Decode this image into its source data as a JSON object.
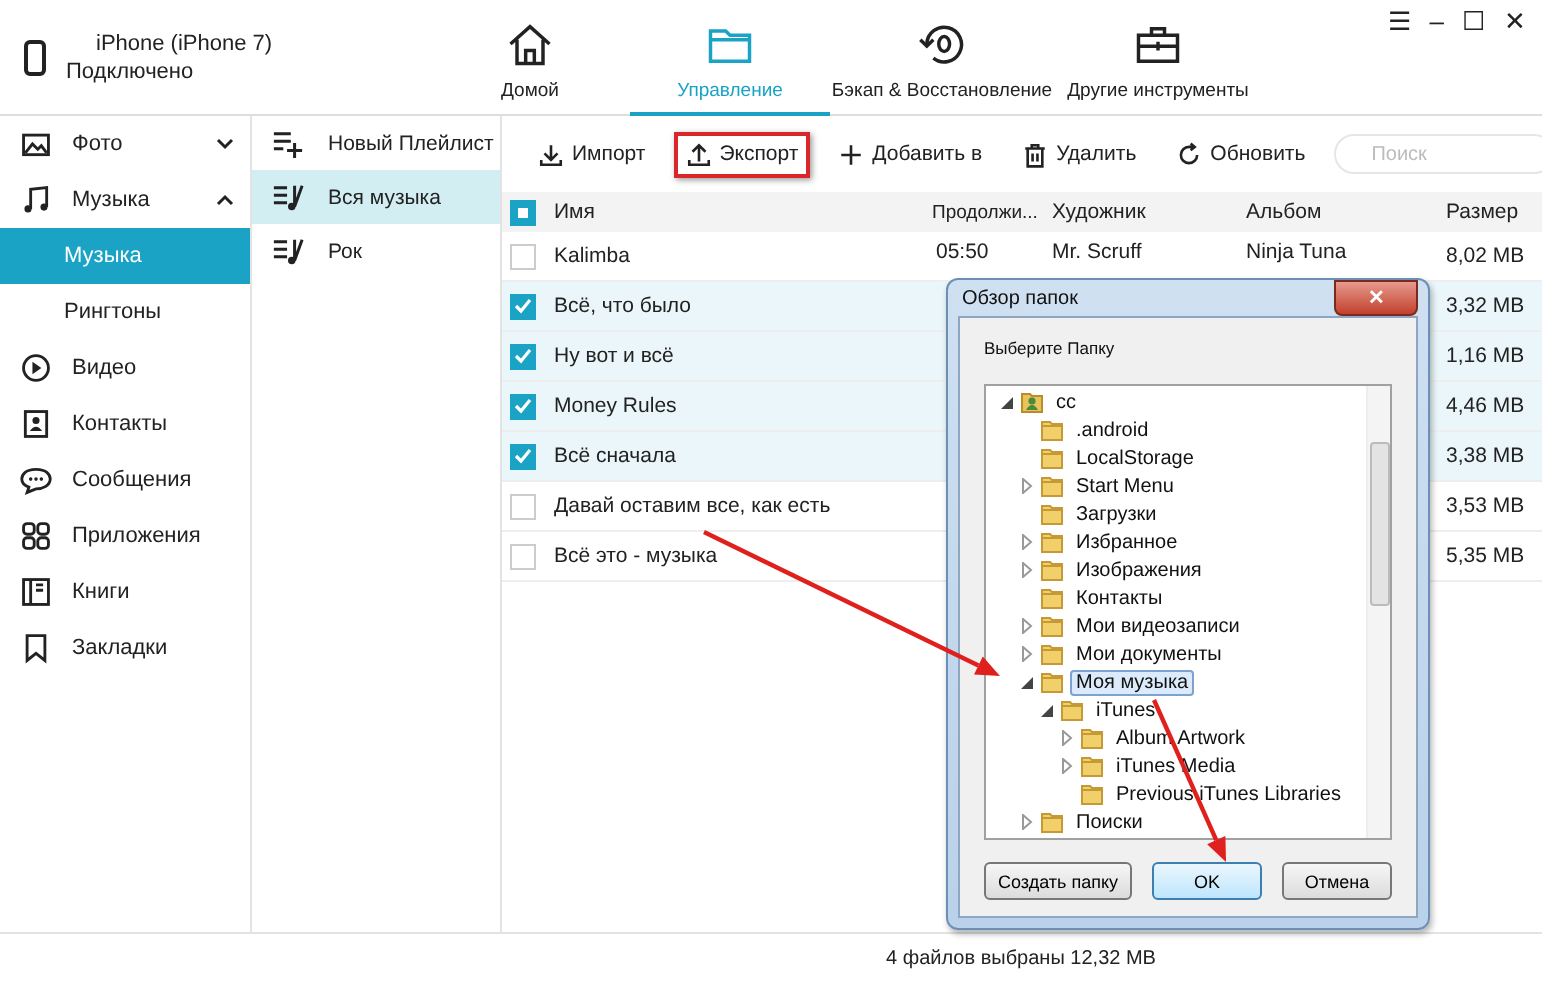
{
  "device": {
    "name": "iPhone (iPhone 7)",
    "status": "Подключено"
  },
  "nav_tabs": [
    {
      "label": "Домой",
      "kind": "home",
      "selected": false
    },
    {
      "label": "Управление",
      "kind": "folder",
      "selected": true
    },
    {
      "label": "Бэкап & Восстановление",
      "kind": "backup",
      "selected": false
    },
    {
      "label": "Другие инструменты",
      "kind": "toolbox",
      "selected": false
    }
  ],
  "window_controls": [
    "☰",
    "–",
    "☐",
    "✕"
  ],
  "sidebar": {
    "items": [
      {
        "label": "Фото",
        "kind": "photo",
        "expanded": false,
        "selected": false
      },
      {
        "label": "Музыка",
        "kind": "music",
        "expanded": true,
        "selected": false
      },
      {
        "label": "Музыка",
        "kind": "sub",
        "selected": true
      },
      {
        "label": "Рингтоны",
        "kind": "sub",
        "selected": false
      },
      {
        "label": "Видео",
        "kind": "video",
        "selected": false
      },
      {
        "label": "Контакты",
        "kind": "contacts",
        "selected": false
      },
      {
        "label": "Сообщения",
        "kind": "messages",
        "selected": false
      },
      {
        "label": "Приложения",
        "kind": "apps",
        "selected": false
      },
      {
        "label": "Книги",
        "kind": "books",
        "selected": false
      },
      {
        "label": "Закладки",
        "kind": "bookmarks",
        "selected": false
      }
    ]
  },
  "playlists": [
    {
      "label": "Новый Плейлист",
      "kind": "new",
      "selected": false
    },
    {
      "label": "Вся музыка",
      "kind": "list",
      "selected": true
    },
    {
      "label": "Рок",
      "kind": "list",
      "selected": false
    }
  ],
  "toolbar": [
    {
      "label": "Импорт",
      "kind": "import",
      "highlighted": false
    },
    {
      "label": "Экспорт",
      "kind": "export",
      "highlighted": true
    },
    {
      "label": "Добавить в",
      "kind": "add",
      "highlighted": false
    },
    {
      "label": "Удалить",
      "kind": "delete",
      "highlighted": false
    },
    {
      "label": "Обновить",
      "kind": "refresh",
      "highlighted": false
    }
  ],
  "search": {
    "placeholder": "Поиск"
  },
  "table": {
    "columns": [
      "Имя",
      "Продолжи...",
      "Художник",
      "Альбом",
      "Размер"
    ],
    "partially_checked": true,
    "rows": [
      {
        "checked": false,
        "cells": [
          "Kalimba",
          "05:50",
          "Mr. Scruff",
          "Ninja Tuna",
          "8,02 MB"
        ]
      },
      {
        "checked": true,
        "cells": [
          "Всё, что было",
          "",
          "",
          "",
          "3,32 MB"
        ]
      },
      {
        "checked": true,
        "cells": [
          "Ну вот и всё",
          "",
          "",
          "",
          "1,16 MB"
        ]
      },
      {
        "checked": true,
        "cells": [
          "Money Rules",
          "",
          "",
          "",
          "4,46 MB"
        ]
      },
      {
        "checked": true,
        "cells": [
          "Всё сначала",
          "",
          "",
          "",
          "3,38 MB"
        ]
      },
      {
        "checked": false,
        "cells": [
          "Давай оставим все, как есть",
          "",
          "",
          "",
          "3,53 MB"
        ]
      },
      {
        "checked": false,
        "cells": [
          "Всё это - музыка",
          "",
          "",
          "",
          "5,35 MB"
        ]
      }
    ]
  },
  "status_bar": "4 файлов выбраны 12,32 MB",
  "dialog": {
    "title": "Обзор папок",
    "close": "✕",
    "prompt": "Выберите Папку",
    "tree": [
      {
        "label": "cc",
        "kind": "user",
        "expanded": true,
        "selected": false,
        "children": [
          {
            "label": ".android",
            "kind": "folder",
            "selected": false
          },
          {
            "label": "LocalStorage",
            "kind": "folder",
            "selected": false
          },
          {
            "label": "Start Menu",
            "kind": "folder",
            "expanded": false,
            "selected": false
          },
          {
            "label": "Загрузки",
            "kind": "folder",
            "selected": false
          },
          {
            "label": "Избранное",
            "kind": "folder",
            "expanded": false,
            "selected": false
          },
          {
            "label": "Изображения",
            "kind": "folder",
            "expanded": false,
            "selected": false
          },
          {
            "label": "Контакты",
            "kind": "folder",
            "selected": false
          },
          {
            "label": "Мои видеозаписи",
            "kind": "folder",
            "expanded": false,
            "selected": false
          },
          {
            "label": "Мои документы",
            "kind": "folder",
            "expanded": false,
            "selected": false
          },
          {
            "label": "Моя музыка",
            "kind": "folder",
            "expanded": true,
            "selected": true,
            "children": [
              {
                "label": "iTunes",
                "kind": "folder",
                "expanded": true,
                "selected": false,
                "children": [
                  {
                    "label": "Album Artwork",
                    "kind": "folder",
                    "expanded": false,
                    "selected": false
                  },
                  {
                    "label": "iTunes Media",
                    "kind": "folder",
                    "expanded": false,
                    "selected": false
                  },
                  {
                    "label": "Previous iTunes Libraries",
                    "kind": "folder",
                    "selected": false
                  }
                ]
              }
            ]
          },
          {
            "label": "Поиски",
            "kind": "folder",
            "expanded": false,
            "selected": false
          }
        ]
      }
    ],
    "buttons": [
      {
        "label": "Создать папку",
        "focused": false
      },
      {
        "label": "OK",
        "focused": true
      },
      {
        "label": "Отмена",
        "focused": false
      }
    ]
  },
  "annotations": [
    {
      "kind": "arrow"
    },
    {
      "kind": "arrow"
    }
  ]
}
